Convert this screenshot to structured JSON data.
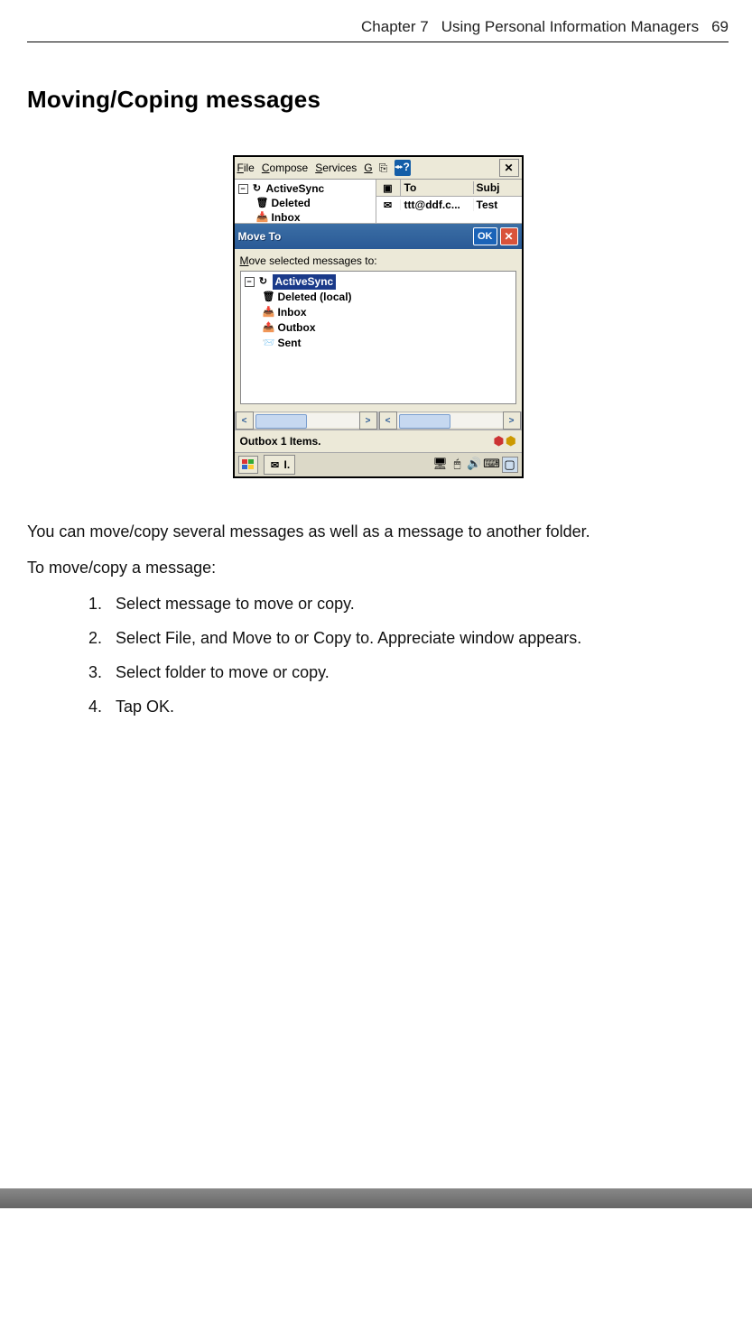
{
  "header": {
    "chapter": "Chapter 7",
    "title": "Using Personal Information Managers",
    "page": "69"
  },
  "section_title": "Moving/Coping messages",
  "screenshot": {
    "menu": {
      "file": "File",
      "compose": "Compose",
      "services": "Services",
      "extra": "G"
    },
    "upper_tree": {
      "root": "ActiveSync",
      "deleted": "Deleted",
      "inbox": "Inbox"
    },
    "msg_header": {
      "to": "To",
      "subj": "Subj"
    },
    "msg_row": {
      "to": "ttt@ddf.c...",
      "subj": "Test"
    },
    "dialog": {
      "title": "Move To",
      "ok": "OK",
      "label": "Move selected messages to:",
      "tree": {
        "root": "ActiveSync",
        "deleted": "Deleted (local)",
        "inbox": "Inbox",
        "outbox": "Outbox",
        "sent": "Sent"
      }
    },
    "status": "Outbox 1 Items.",
    "taskbar_label": "I."
  },
  "body": {
    "p1": "You can move/copy several messages as well as a message to another folder.",
    "p2": "To move/copy a message:",
    "steps": [
      "Select message to move or copy.",
      "Select File, and Move to or Copy to. Appreciate window appears.",
      "Select folder to move or copy.",
      "Tap OK."
    ]
  }
}
